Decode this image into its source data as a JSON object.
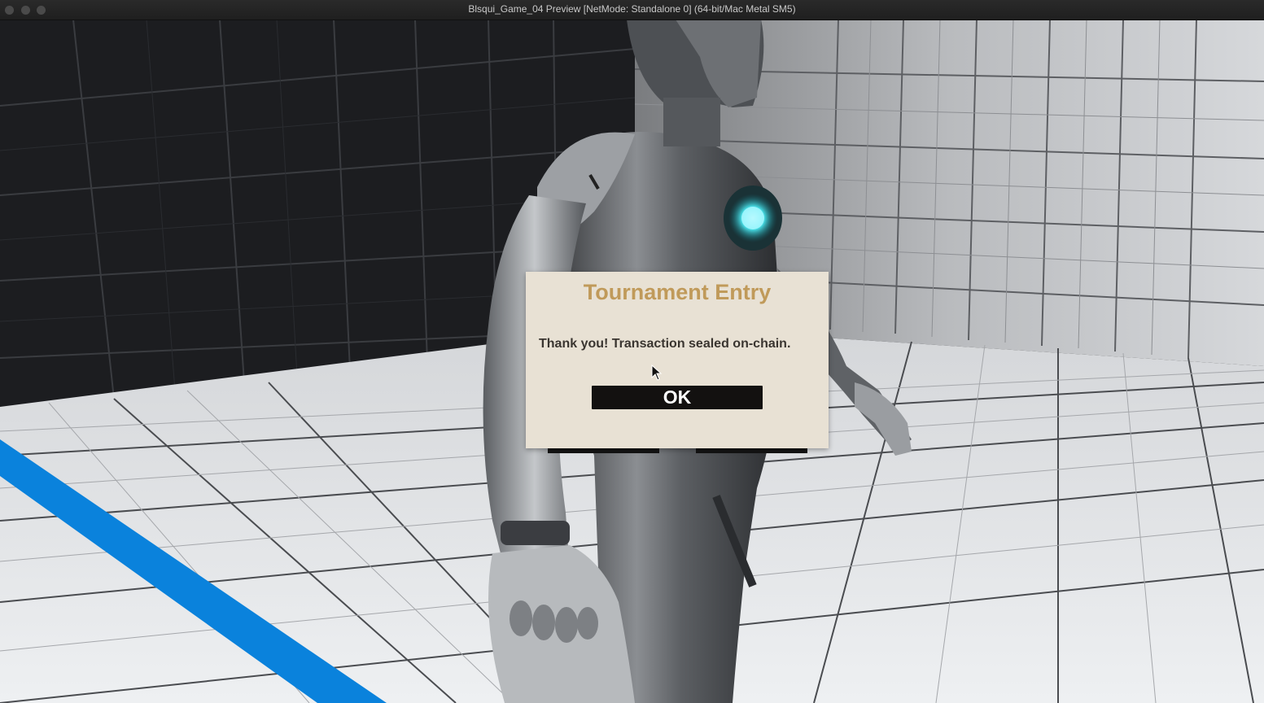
{
  "window": {
    "title": "Blsqui_Game_04 Preview [NetMode: Standalone 0]  (64-bit/Mac Metal SM5)"
  },
  "dialog": {
    "title": "Tournament Entry",
    "message": "Thank you! Transaction sealed on-chain.",
    "ok_label": "OK"
  },
  "colors": {
    "dialog_background": "#e8e1d4",
    "dialog_title": "#c09a5a",
    "button_background": "#131110",
    "floor_stripe": "#0a82dc",
    "chest_glow": "#4be8f0"
  },
  "icons": {
    "window_controls": [
      "close-icon",
      "minimize-icon",
      "zoom-icon"
    ],
    "pointer": "mouse-cursor-icon"
  }
}
